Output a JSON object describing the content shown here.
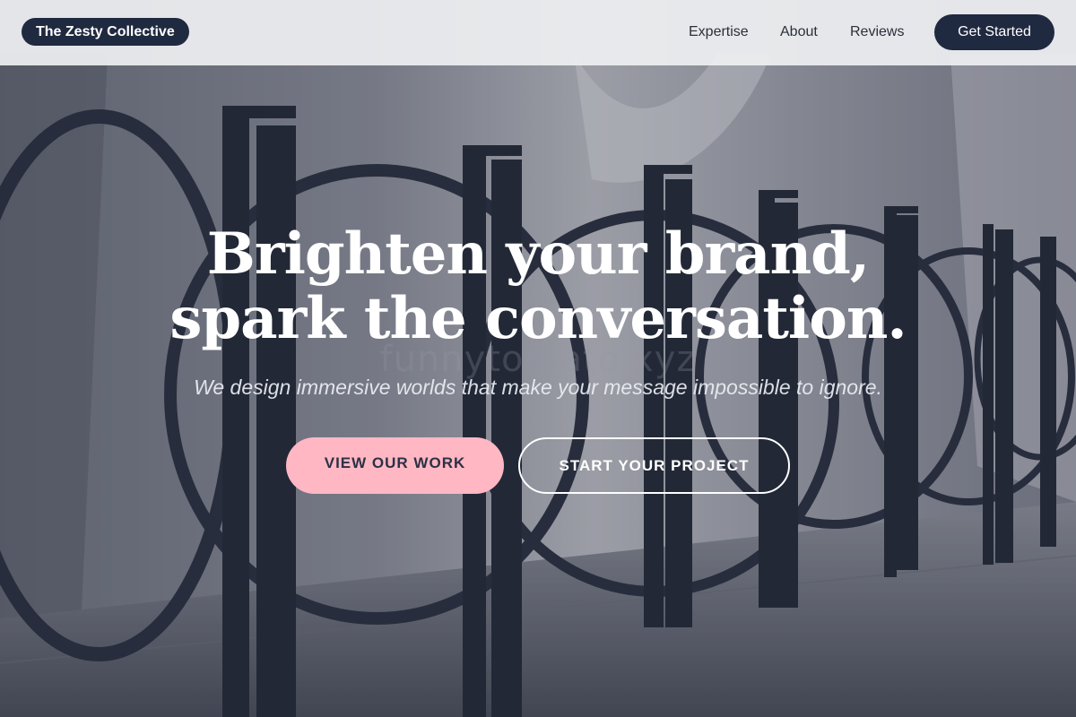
{
  "header": {
    "brand": "The Zesty Collective",
    "nav": [
      {
        "label": "Expertise"
      },
      {
        "label": "About"
      },
      {
        "label": "Reviews"
      }
    ],
    "cta_label": "Get Started"
  },
  "hero": {
    "title_line1": "Brighten your brand,",
    "title_line2": "spark the conversation.",
    "subtitle": "We design immersive worlds that make your message impossible to ignore.",
    "primary_button": "VIEW OUR WORK",
    "secondary_button": "START YOUR PROJECT"
  },
  "watermark": "funnytomato.xyz",
  "colors": {
    "header_bg": "#eeeff1",
    "dark_navy": "#1f2940",
    "pink_accent": "#ffb7c3",
    "white": "#ffffff"
  }
}
